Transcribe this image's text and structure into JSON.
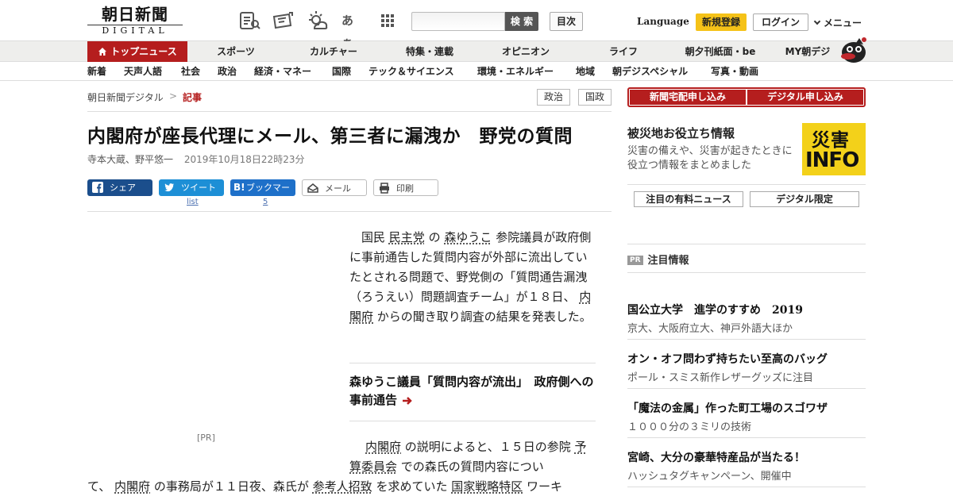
{
  "header": {
    "logo_main": "朝日新聞",
    "logo_sub": "DIGITAL",
    "search_placeholder": "",
    "search_button": "検 索",
    "toc_button": "目次",
    "language": "Language",
    "signup": "新規登録",
    "login": "ログイン",
    "menu": "メニュー",
    "icons": [
      "newspaper-icon",
      "ticket-icon",
      "weather-icon",
      "font-size-icon",
      "apps-grid-icon"
    ],
    "font_size_glyph": "あぁ"
  },
  "nav1": {
    "top": "トップニュース",
    "items": [
      "スポーツ",
      "カルチャー",
      "特集・連載",
      "オピニオン",
      "ライフ",
      "朝夕刊紙面・be",
      "MY朝デジ"
    ]
  },
  "nav2": {
    "items": [
      "新着",
      "天声人語",
      "社会",
      "政治",
      "経済・マネー",
      "国際",
      "テック＆サイエンス",
      "環境・エネルギー",
      "地域",
      "朝デジスペシャル",
      "写真・動画"
    ]
  },
  "breadcrumb": {
    "home": "朝日新聞デジタル",
    "sep": ">",
    "current": "記事"
  },
  "tags": [
    "政治",
    "国政"
  ],
  "article": {
    "title": "内閣府が座長代理にメール、第三者に漏洩か　野党の質問",
    "authors": "寺本大蔵、野平悠一",
    "date": "2019年10月18日22時23分",
    "share": {
      "facebook": "シェア",
      "twitter": "ツイート",
      "hatena": "ブックマーク",
      "mail": "メール",
      "print": "印刷",
      "twitter_count": "list",
      "hatena_count": "5"
    },
    "p1": {
      "a": "国民",
      "l1": "民主党",
      "b": "の",
      "l2": "森ゆうこ",
      "c": "参院議員が政府側に事前通告した質問内容が外部に流出していたとされる問題で、野党側の「質問通告漏洩（ろうえい）問題調査チーム」が１８日、",
      "l3": "内閣府",
      "d": "からの聞き取り調査の結果を発表した。"
    },
    "related": "森ゆうこ議員「質問内容が流出」　政府側への事前通告",
    "pr_label": "[PR]",
    "p2": {
      "l1": "内閣府",
      "a": "の説明によると、１５日の参院",
      "l2": "予算委員会",
      "b": "での森氏の質問内容につい"
    },
    "p3": {
      "a": "て、",
      "l1": "内閣府",
      "b": "の事務局が１１日夜、森氏が",
      "l2": "参考人招致",
      "c": "を求めていた",
      "l3": "国家戦略特区",
      "d": "ワーキ"
    }
  },
  "sidebar": {
    "subscribe_paper": "新聞宅配申し込み",
    "subscribe_digital": "デジタル申し込み",
    "disaster_title": "被災地お役立ち情報",
    "disaster_desc": "災害の備えや、災害が起きたときに役立つ情報をまとめました",
    "disaster_logo_top": "災害",
    "disaster_logo_bottom": "INFO",
    "btn_paid_news": "注目の有料ニュース",
    "btn_digital_only": "デジタル限定",
    "pr_badge": "PR",
    "pr_heading": "注目情報",
    "pr_items": [
      {
        "title": "国公立大学　進学のすすめ　2019",
        "sub": "京大、大阪府立大、神戸外語大ほか"
      },
      {
        "title": "オン・オフ問わず持ちたい至高のバッグ",
        "sub": "ポール・スミス新作レザーグッズに注目"
      },
      {
        "title": "「魔法の金属」作った町工場のスゴワザ",
        "sub": "１０００分の３ミリの技術"
      },
      {
        "title": "宮崎、大分の豪華特産品が当たる！",
        "sub": "ハッシュタグキャンペーン、開催中"
      }
    ]
  },
  "colors": {
    "brand_red": "#b51e1e",
    "signup_yellow": "#f5c218",
    "facebook": "#1b4e8c",
    "twitter": "#1d8fd6",
    "hatena": "#1e70c9"
  }
}
